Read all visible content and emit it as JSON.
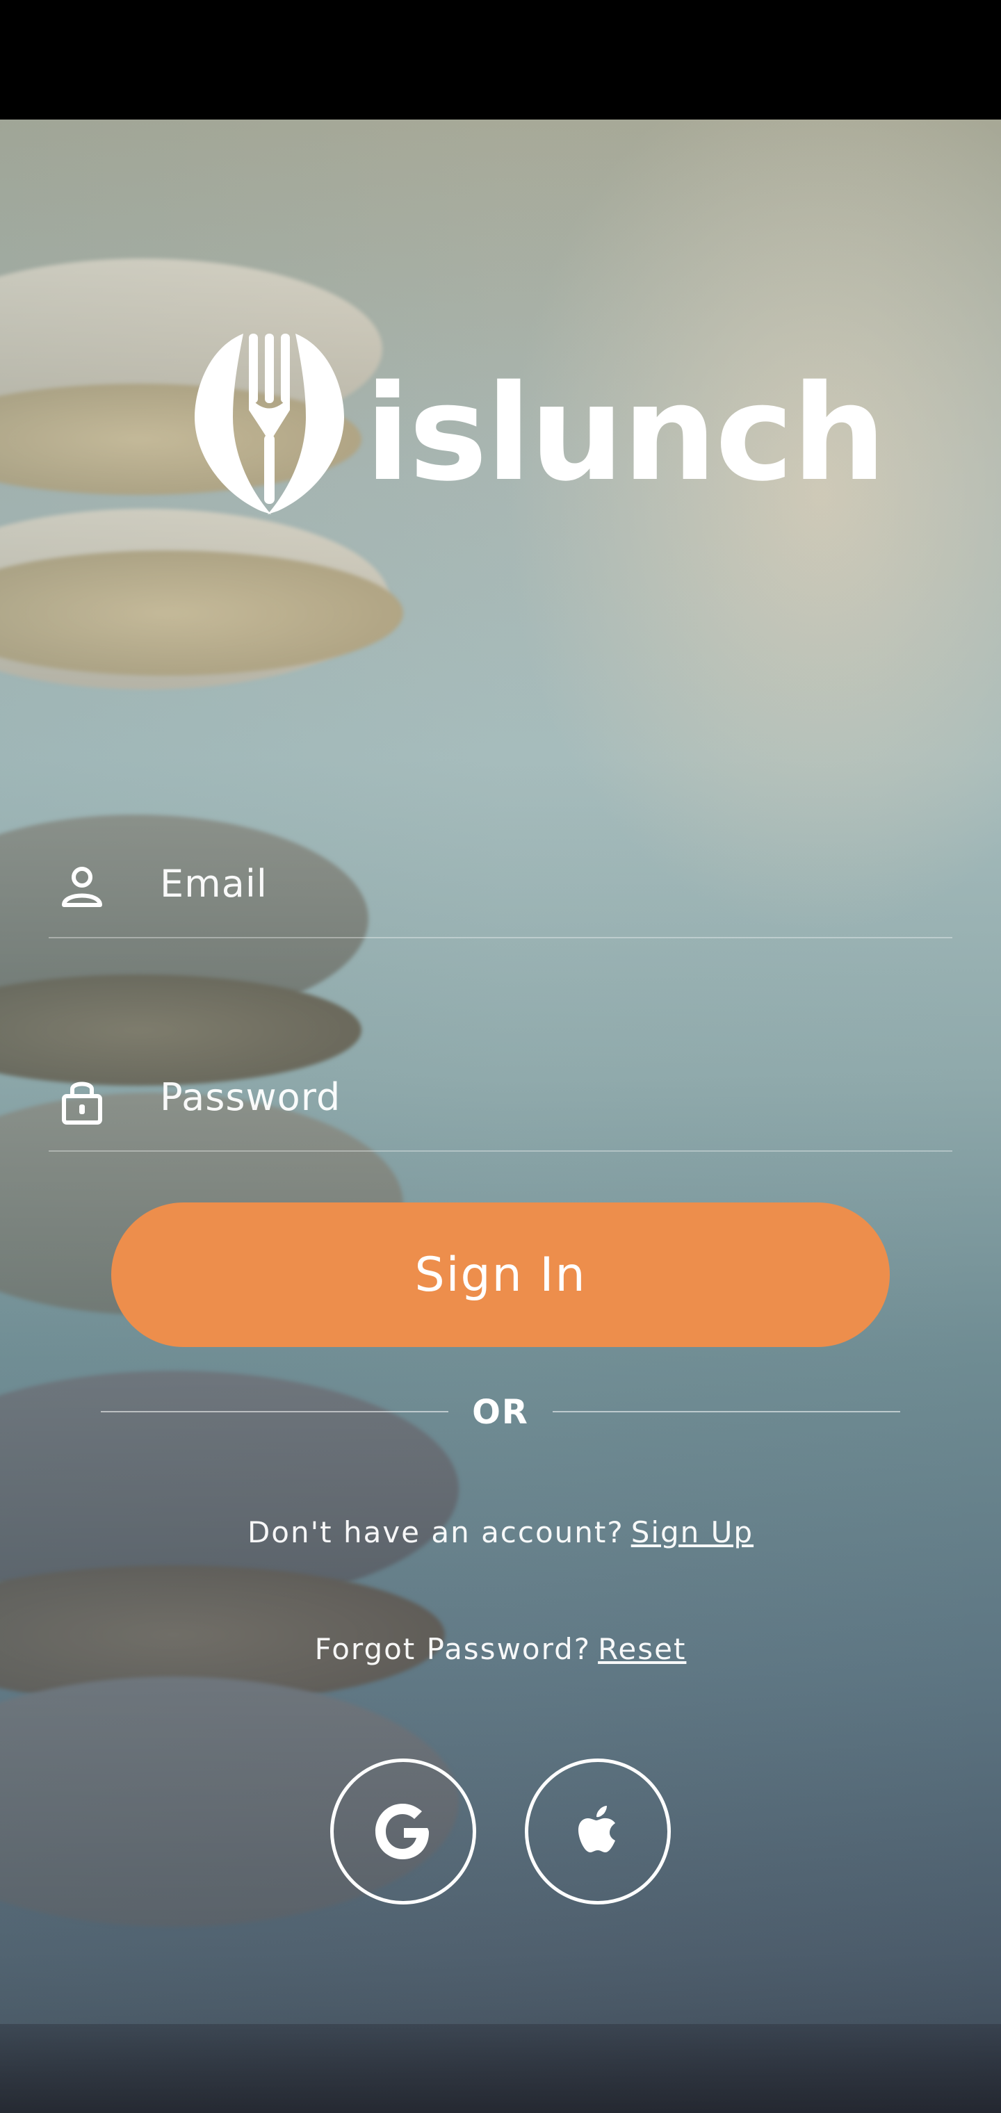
{
  "app": {
    "name": "islunch"
  },
  "logo": {
    "text": "islunch",
    "icon": "fork-spoon-logo-icon"
  },
  "login": {
    "email_placeholder": "Email",
    "email_icon": "person-icon",
    "password_placeholder": "Password",
    "password_icon": "lock-icon",
    "sign_in_label": "Sign In",
    "or_label": "OR"
  },
  "links": {
    "no_account_text": "Don't have an account?",
    "sign_up_label": "Sign Up",
    "forgot_text": "Forgot Password?",
    "reset_label": "Reset"
  },
  "social": [
    {
      "provider": "Google",
      "icon": "google-icon"
    },
    {
      "provider": "Apple",
      "icon": "apple-icon"
    }
  ],
  "colors": {
    "accent": "#ED8E4C",
    "text": "#FFFFFF",
    "status_bar": "#000000"
  }
}
